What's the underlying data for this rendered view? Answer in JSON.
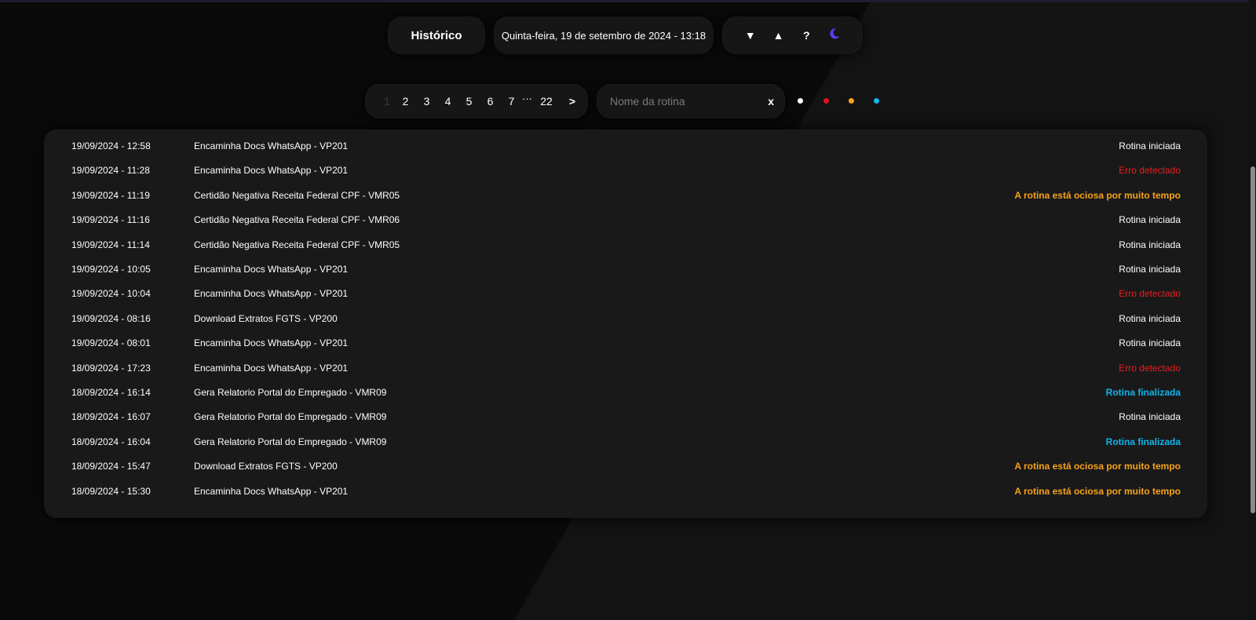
{
  "header": {
    "history_label": "Histórico",
    "datetime_text": "Quinta-feira, 19 de setembro de 2024 - 13:18",
    "controls": {
      "collapse_label": "▼",
      "expand_label": "▲",
      "help_label": "?",
      "theme_icon": "moon-icon"
    }
  },
  "pagination": {
    "pages": [
      "1",
      "2",
      "3",
      "4",
      "5",
      "6",
      "7"
    ],
    "ellipsis": "···",
    "last_page": "22",
    "next_label": ">",
    "current_page": "1"
  },
  "search": {
    "placeholder": "Nome da rotina",
    "value": "",
    "clear_label": "x"
  },
  "filters": [
    {
      "name": "white",
      "color": "#ffffff"
    },
    {
      "name": "red",
      "color": "#e3131b"
    },
    {
      "name": "orange",
      "color": "#f7a21a"
    },
    {
      "name": "blue",
      "color": "#13b5ea"
    }
  ],
  "status_colors": {
    "Rotina iniciada": "#ffffff",
    "Erro detectado": "#ec1c1c",
    "A rotina está ociosa por muito tempo": "#f7a21a",
    "Rotina finalizada": "#12b4ea"
  },
  "logs": [
    {
      "datetime": "19/09/2024 - 12:58",
      "routine": "Encaminha Docs WhatsApp - VP201",
      "status": "Rotina iniciada"
    },
    {
      "datetime": "19/09/2024 - 11:28",
      "routine": "Encaminha Docs WhatsApp - VP201",
      "status": "Erro detectado"
    },
    {
      "datetime": "19/09/2024 - 11:19",
      "routine": "Certidão Negativa Receita Federal CPF - VMR05",
      "status": "A rotina está ociosa por muito tempo"
    },
    {
      "datetime": "19/09/2024 - 11:16",
      "routine": "Certidão Negativa Receita Federal CPF - VMR06",
      "status": "Rotina iniciada"
    },
    {
      "datetime": "19/09/2024 - 11:14",
      "routine": "Certidão Negativa Receita Federal CPF - VMR05",
      "status": "Rotina iniciada"
    },
    {
      "datetime": "19/09/2024 - 10:05",
      "routine": "Encaminha Docs WhatsApp - VP201",
      "status": "Rotina iniciada"
    },
    {
      "datetime": "19/09/2024 - 10:04",
      "routine": "Encaminha Docs WhatsApp - VP201",
      "status": "Erro detectado"
    },
    {
      "datetime": "19/09/2024 - 08:16",
      "routine": "Download Extratos FGTS - VP200",
      "status": "Rotina iniciada"
    },
    {
      "datetime": "19/09/2024 - 08:01",
      "routine": "Encaminha Docs WhatsApp - VP201",
      "status": "Rotina iniciada"
    },
    {
      "datetime": "18/09/2024 - 17:23",
      "routine": "Encaminha Docs WhatsApp - VP201",
      "status": "Erro detectado"
    },
    {
      "datetime": "18/09/2024 - 16:14",
      "routine": "Gera Relatorio Portal do Empregado - VMR09",
      "status": "Rotina finalizada"
    },
    {
      "datetime": "18/09/2024 - 16:07",
      "routine": "Gera Relatorio Portal do Empregado - VMR09",
      "status": "Rotina iniciada"
    },
    {
      "datetime": "18/09/2024 - 16:04",
      "routine": "Gera Relatorio Portal do Empregado - VMR09",
      "status": "Rotina finalizada"
    },
    {
      "datetime": "18/09/2024 - 15:47",
      "routine": "Download Extratos FGTS - VP200",
      "status": "A rotina está ociosa por muito tempo"
    },
    {
      "datetime": "18/09/2024 - 15:30",
      "routine": "Encaminha Docs WhatsApp - VP201",
      "status": "A rotina está ociosa por muito tempo"
    }
  ]
}
